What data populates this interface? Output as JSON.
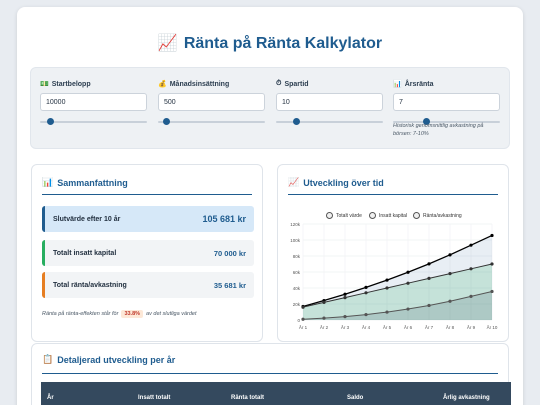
{
  "title": "Ränta på Ränta Kalkylator",
  "title_icon": "chart-up-icon",
  "inputs": [
    {
      "label": "Startbelopp",
      "icon": "money-icon",
      "value": "10000",
      "slider_fraction": 0.07
    },
    {
      "label": "Månadsinsättning",
      "icon": "money-bag-icon",
      "value": "500",
      "slider_fraction": 0.05
    },
    {
      "label": "Spartid",
      "icon": "stopwatch-icon",
      "value": "10",
      "slider_fraction": 0.17
    },
    {
      "label": "Årsränta",
      "icon": "bar-chart-icon",
      "value": "7",
      "slider_fraction": 0.3
    }
  ],
  "hint": "Historisk genomsnittlig avkastning på börsen: 7-10%",
  "summary": {
    "title": "Sammanfattning",
    "final_label": "Slutvärde efter 10 år",
    "final_value": "105 681 kr",
    "invested_label": "Totalt insatt kapital",
    "invested_value": "70 000 kr",
    "return_label": "Total ränta/avkastning",
    "return_value": "35 681 kr",
    "note_prefix": "Ränta på ränta-effekten står för",
    "note_percent": "33.8%",
    "note_suffix": "av det slutliga värdet"
  },
  "chart_panel_title": "Utveckling över tid",
  "table_panel_title": "Detaljerad utveckling per år",
  "table_headers": [
    "År",
    "Insatt totalt",
    "Ränta totalt",
    "Saldo",
    "Årlig avkastning"
  ],
  "colors": {
    "accent": "#1f5c8f",
    "green": "#27ae60",
    "orange": "#e67e22",
    "total": "#000000",
    "invested": "#333333",
    "interest": "#555555"
  },
  "chart_data": {
    "type": "line",
    "x": [
      "År 1",
      "År 2",
      "År 3",
      "År 4",
      "År 5",
      "År 6",
      "År 7",
      "År 8",
      "År 9",
      "År 10"
    ],
    "ylim": [
      0,
      120000
    ],
    "yticks": [
      "0",
      "20k",
      "40k",
      "60k",
      "80k",
      "100k",
      "120k"
    ],
    "legend_position": "top",
    "grid": true,
    "series": [
      {
        "name": "Totalt värde",
        "values": [
          16907,
          24314,
          32255,
          40770,
          49901,
          59691,
          70189,
          81446,
          93516,
          105681
        ]
      },
      {
        "name": "Insatt kapital",
        "values": [
          16000,
          22000,
          28000,
          34000,
          40000,
          46000,
          52000,
          58000,
          64000,
          70000
        ]
      },
      {
        "name": "Ränta/avkastning",
        "values": [
          907,
          2314,
          4255,
          6770,
          9901,
          13691,
          18189,
          23446,
          29516,
          35681
        ]
      }
    ]
  }
}
